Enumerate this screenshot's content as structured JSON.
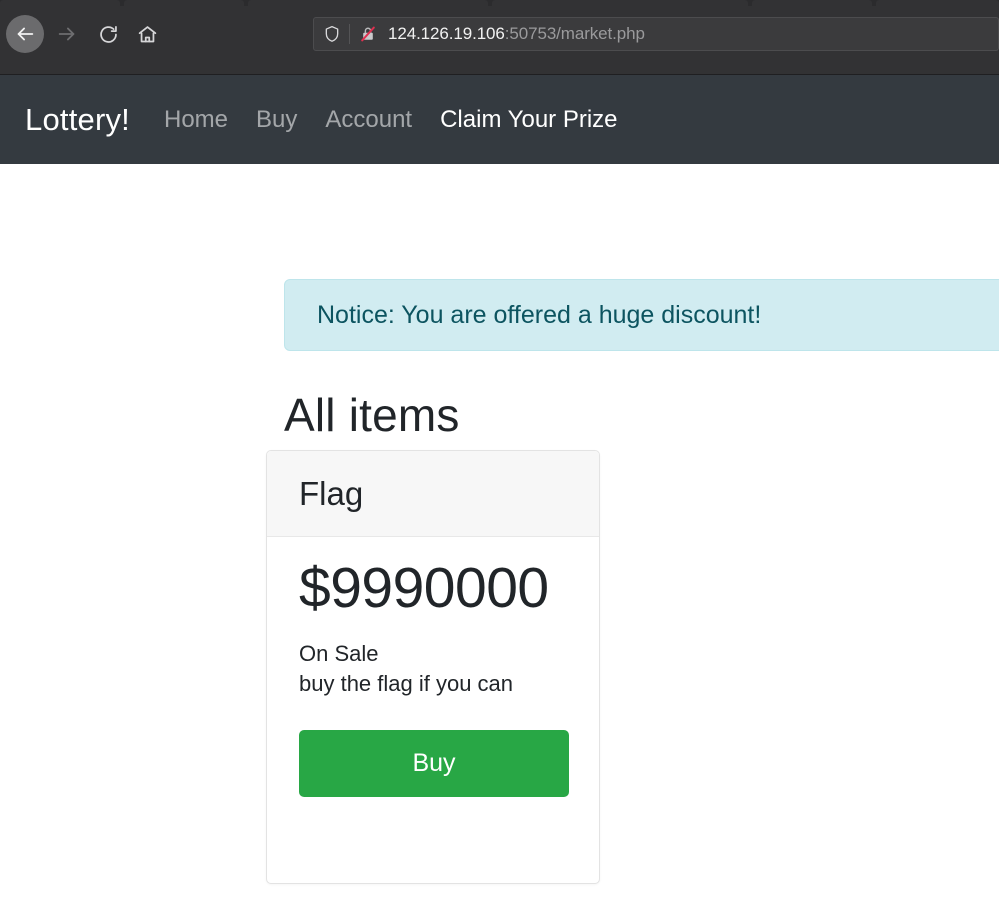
{
  "browser": {
    "back_icon": "back-arrow-icon",
    "forward_icon": "forward-arrow-icon",
    "reload_icon": "reload-icon",
    "home_icon": "home-icon",
    "shield_icon": "shield-icon",
    "insecure_icon": "insecure-connection-icon",
    "url_host": "124.126.19.106",
    "url_path": ":50753/market.php",
    "url_full": "124.126.19.106:50753/market.php"
  },
  "navbar": {
    "brand": "Lottery!",
    "links": [
      {
        "label": "Home",
        "active": false
      },
      {
        "label": "Buy",
        "active": false
      },
      {
        "label": "Account",
        "active": false
      },
      {
        "label": "Claim Your Prize",
        "active": true
      }
    ]
  },
  "alert": {
    "text": "Notice: You are offered a huge discount!",
    "bg_color": "#d1ecf1",
    "text_color": "#0c5460"
  },
  "main": {
    "heading": "All items",
    "card": {
      "title": "Flag",
      "price": "$9990000",
      "status": "On Sale",
      "description": "buy the flag if you can",
      "buy_label": "Buy",
      "buy_color": "#28a745"
    }
  }
}
